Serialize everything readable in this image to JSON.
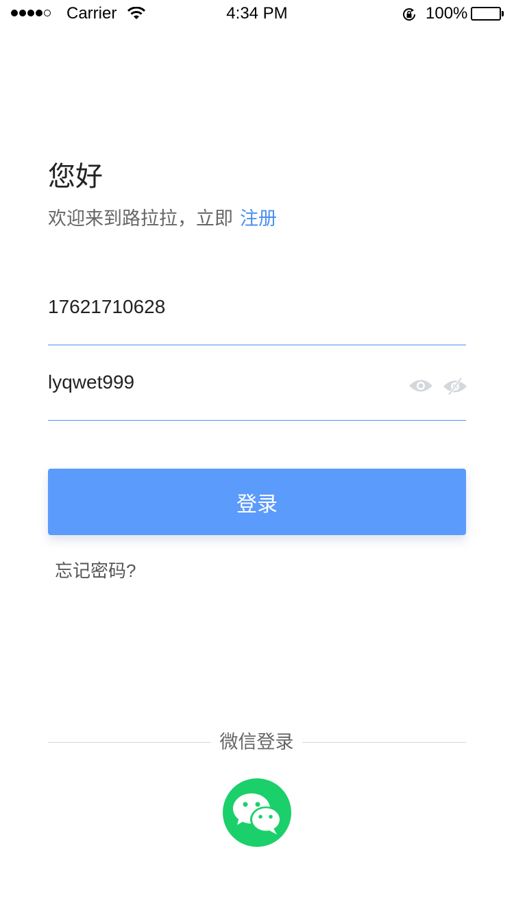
{
  "status_bar": {
    "carrier": "Carrier",
    "time": "4:34 PM",
    "battery_percent": "100%",
    "signal_strength": 4,
    "signal_max": 5
  },
  "greeting": {
    "title": "您好",
    "welcome_text": "欢迎来到路拉拉，立即",
    "register_label": "注册"
  },
  "form": {
    "phone_value": "17621710628",
    "password_value": "lyqwet999"
  },
  "login_button_label": "登录",
  "forgot_password_label": "忘记密码?",
  "wechat": {
    "label": "微信登录"
  },
  "colors": {
    "accent": "#4a8ff0",
    "button": "#5b9bfc",
    "wechat": "#1bd06a"
  },
  "icons": [
    "wifi-icon",
    "rotation-lock-icon",
    "battery-icon",
    "eye-icon",
    "eye-off-icon",
    "wechat-icon"
  ]
}
